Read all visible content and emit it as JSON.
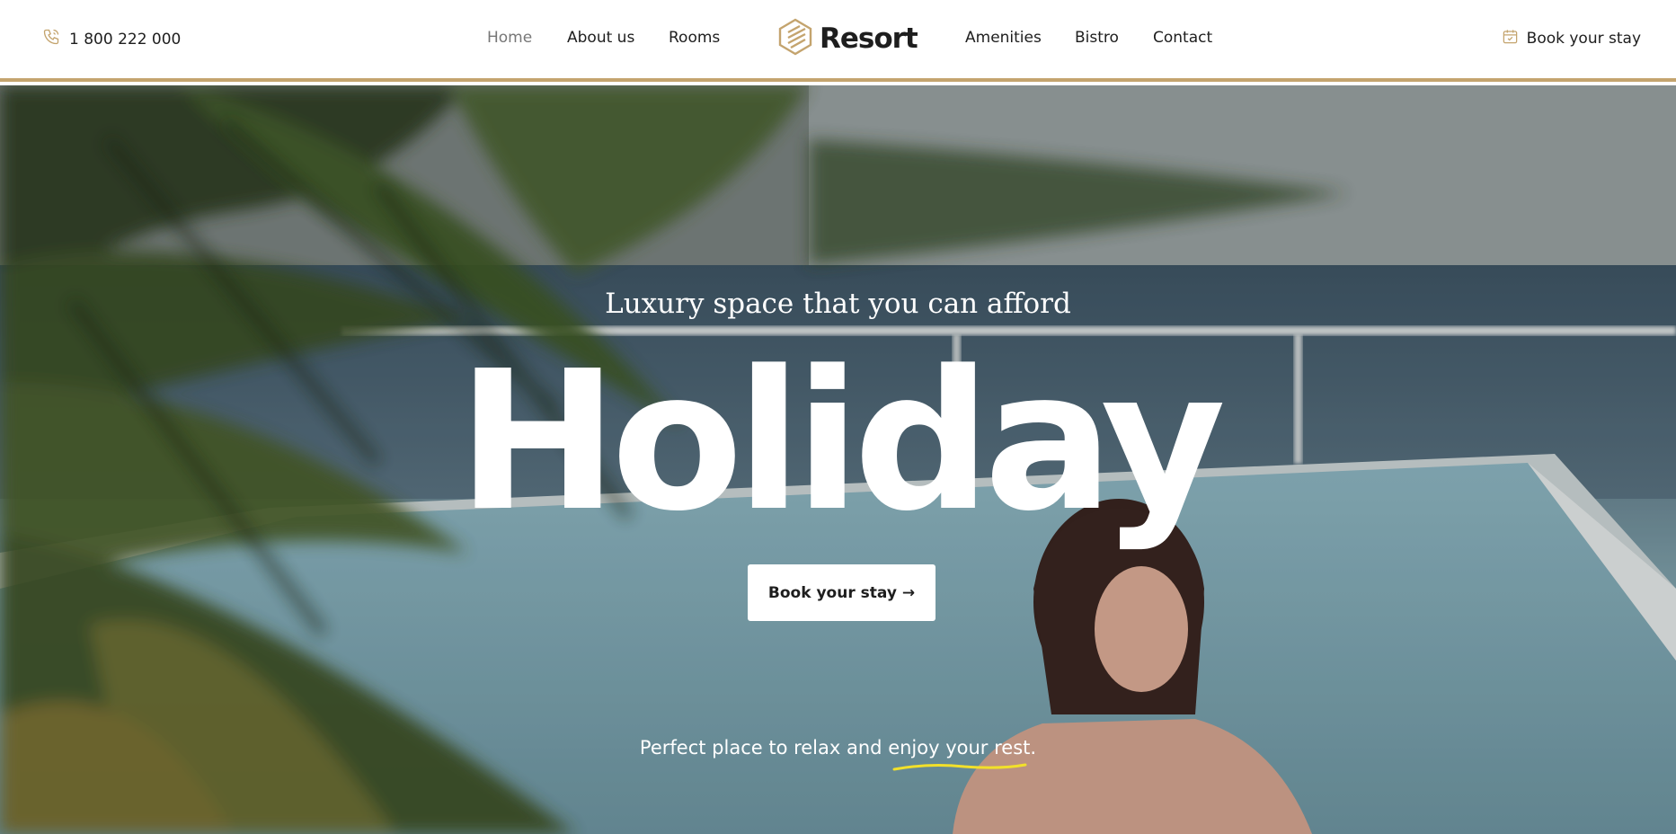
{
  "header": {
    "phone": "1 800 222 000",
    "nav_left": [
      "Home",
      "About us",
      "Rooms"
    ],
    "logo_text": "Resort",
    "nav_right": [
      "Amenities",
      "Bistro",
      "Contact"
    ],
    "book_label": "Book your stay",
    "accent_color": "#c4a46e"
  },
  "hero": {
    "tagline": "Luxury space that you can afford",
    "title": "Holiday",
    "cta_label": "Book your stay →",
    "sub_text_plain": "Perfect place to relax and ",
    "sub_text_highlight": "enjoy your rest",
    "sub_text_end": ".",
    "highlight_color": "#f2e02a"
  },
  "icons": [
    "phone-icon",
    "logo-icon",
    "calendar-icon"
  ]
}
